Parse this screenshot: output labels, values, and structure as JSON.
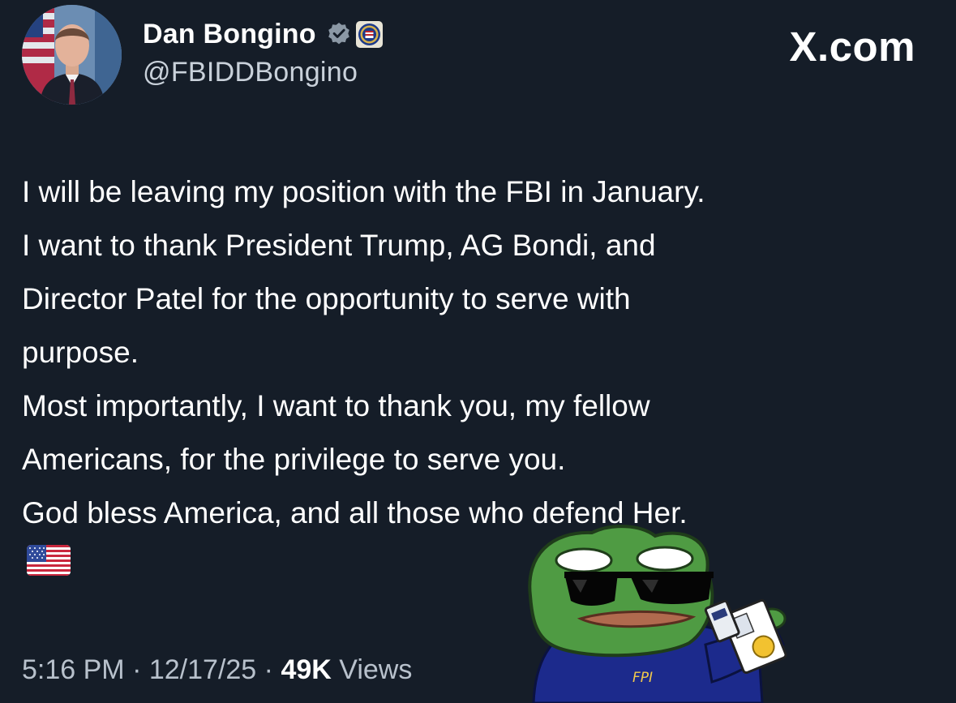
{
  "brand": {
    "label": "X.com"
  },
  "author": {
    "display_name": "Dan Bongino",
    "handle": "@FBIDDBongino",
    "verified_icon": "verified-badge-icon",
    "affiliation_icon": "fbi-seal-icon",
    "avatar_icon": "profile-photo"
  },
  "post": {
    "lines": [
      "I will be leaving my position with the FBI in January.",
      "I want to thank President Trump, AG Bondi, and",
      "Director Patel for the opportunity to serve with",
      "purpose.",
      "Most importantly, I want to thank you, my fellow",
      "Americans, for the privilege to serve you.",
      "God bless America, and all those who defend Her."
    ],
    "emoji": "us-flag-emoji"
  },
  "meta": {
    "time": "5:16 PM",
    "separator": "·",
    "date": "12/17/25",
    "views_count": "49K",
    "views_label": "Views"
  },
  "sticker": {
    "icon": "frog-meme-sticker",
    "jacket_label": "FPI"
  },
  "colors": {
    "background": "#151d28",
    "text": "#ffffff",
    "secondary": "#c9d1da",
    "verified": "#8b98a5",
    "frog_green": "#4f9b43",
    "jacket_navy": "#1c2a8c"
  }
}
